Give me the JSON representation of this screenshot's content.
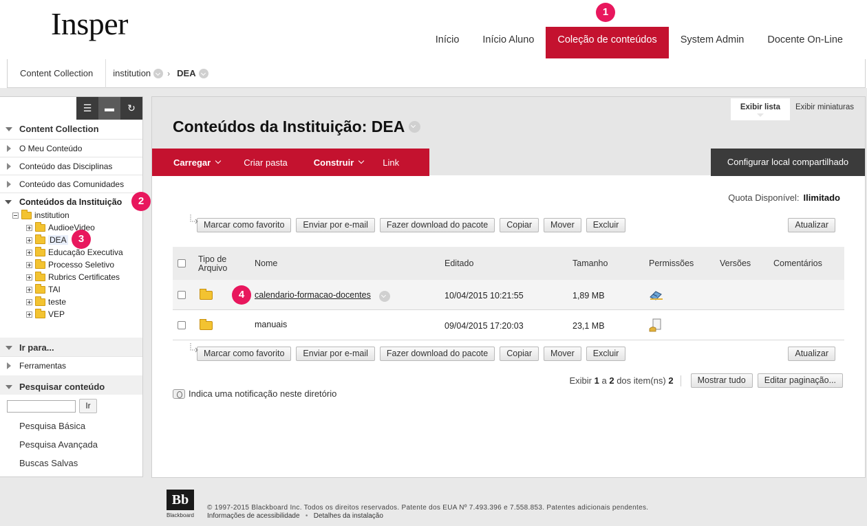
{
  "logo": "Insper",
  "nav": {
    "tabs": [
      {
        "label": "Início"
      },
      {
        "label": "Início Aluno"
      },
      {
        "label": "Coleção de conteúdos",
        "active": true
      },
      {
        "label": "System Admin"
      },
      {
        "label": "Docente On-Line"
      }
    ]
  },
  "badges": [
    "1",
    "2",
    "3",
    "4"
  ],
  "breadcrumb": {
    "home": "Content Collection",
    "items": [
      "institution",
      "DEA"
    ]
  },
  "sidebar": {
    "tools": [
      "list-view-icon",
      "folder-view-icon",
      "refresh-icon"
    ],
    "content_collection_header": "Content Collection",
    "links": [
      "O Meu Conteúdo",
      "Conteúdo das Disciplinas",
      "Conteúdo das Comunidades"
    ],
    "institution_header": "Conteúdos da Instituição",
    "tree": {
      "root": "institution",
      "children": [
        "AudioeVideo",
        "DEA",
        "Educação Executiva",
        "Processo Seletivo",
        "Rubrics Certificates",
        "TAI",
        "teste",
        "VEP"
      ]
    },
    "goto_header": "Ir para...",
    "tools_link": "Ferramentas",
    "search_header": "Pesquisar conteúdo",
    "search_button": "Ir",
    "search_links": [
      "Pesquisa Básica",
      "Pesquisa Avançada",
      "Buscas Salvas"
    ]
  },
  "main": {
    "view_tabs": [
      "Exibir lista",
      "Exibir miniaturas"
    ],
    "title": "Conteúdos da Instituição: DEA",
    "actions": [
      {
        "label": "Carregar",
        "dropdown": true
      },
      {
        "label": "Criar pasta",
        "dropdown": false
      },
      {
        "label": "Construir",
        "dropdown": true
      },
      {
        "label": "Link",
        "dropdown": false
      }
    ],
    "share_button": "Configurar local compartilhado",
    "quota_label": "Quota Disponível:",
    "quota_value": "Ilimitado",
    "toolbar_buttons": [
      "Marcar como favorito",
      "Enviar por e-mail",
      "Fazer download do pacote",
      "Copiar",
      "Mover",
      "Excluir"
    ],
    "update_button": "Atualizar",
    "columns": {
      "type_line1": "Tipo de",
      "type_line2": "Arquivo",
      "name": "Nome",
      "edited": "Editado",
      "size": "Tamanho",
      "permissions": "Permissões",
      "versions": "Versões",
      "comments": "Comentários"
    },
    "rows": [
      {
        "name": "calendario-formacao-docentes",
        "edited": "10/04/2015 10:21:55",
        "size": "1,89 MB",
        "link": true
      },
      {
        "name": "manuais",
        "edited": "09/04/2015 17:20:03",
        "size": "23,1 MB",
        "link": false
      }
    ],
    "pagination": {
      "prefix": "Exibir",
      "from": "1",
      "a": "a",
      "to": "2",
      "middle": "dos item(ns)",
      "total": "2",
      "show_all": "Mostrar tudo",
      "edit": "Editar paginação..."
    },
    "notice": "Indica uma notificação neste diretório"
  },
  "footer": {
    "logo_text": "Bb",
    "logo_caption": "Blackboard",
    "copyright": "© 1997-2015 Blackboard Inc. Todos os direitos reservados. Patente dos EUA Nº 7.493.396 e 7.558.853. Patentes adicionais pendentes.",
    "link_accessibility": "Informações de acessibilidade",
    "separator": "•",
    "link_install": "Detalhes da instalação"
  }
}
